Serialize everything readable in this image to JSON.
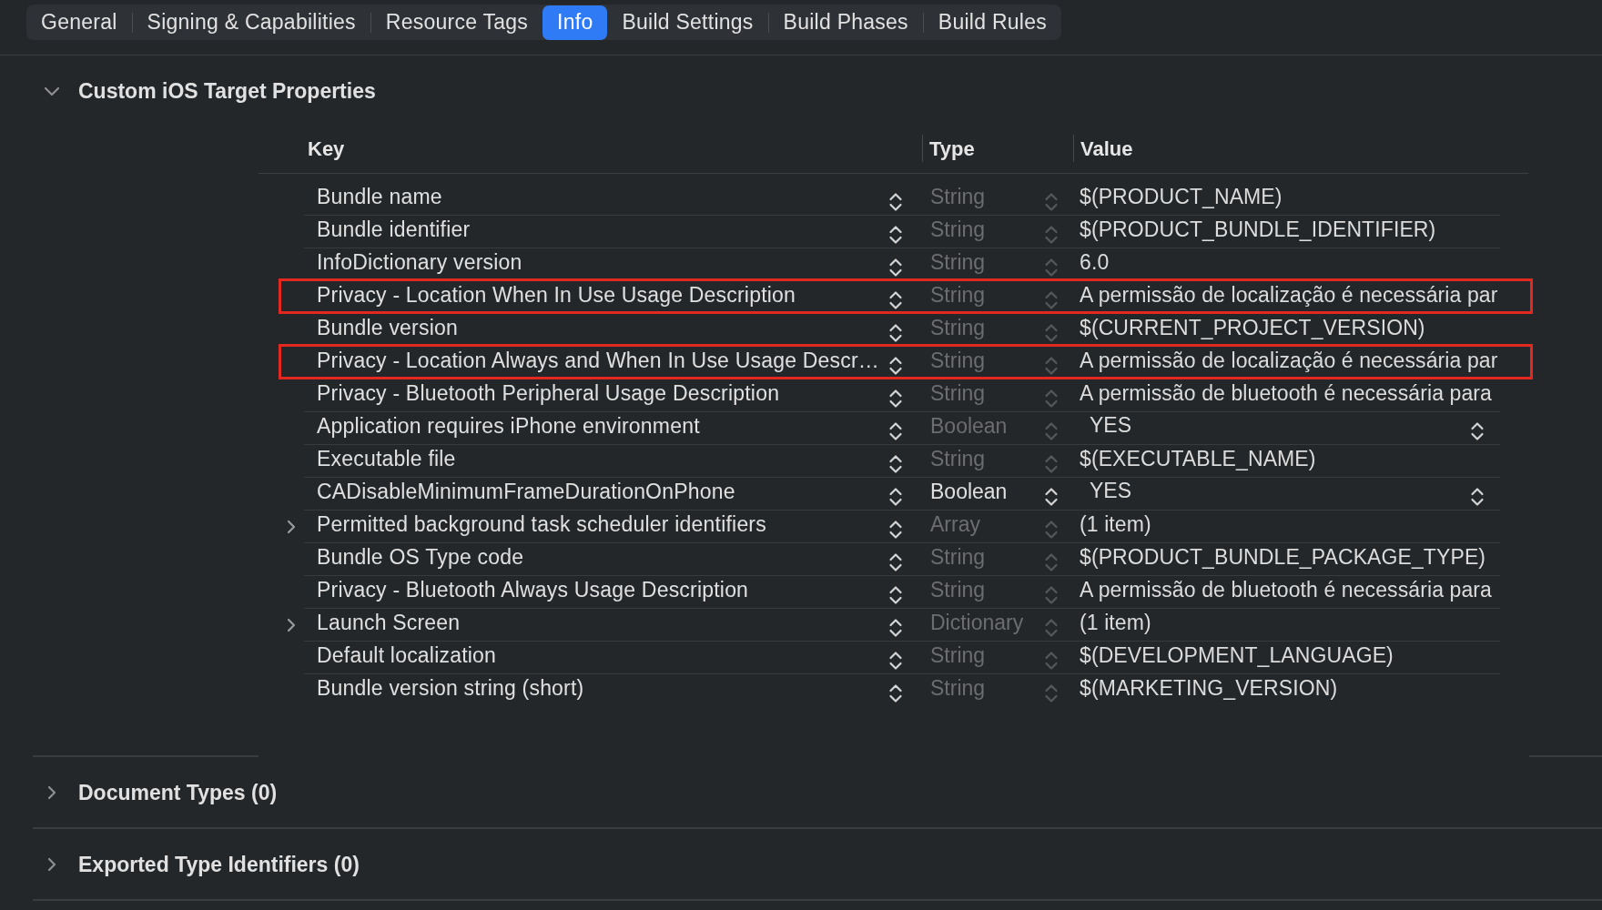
{
  "tabs": [
    {
      "label": "General",
      "selected": false
    },
    {
      "label": "Signing & Capabilities",
      "selected": false
    },
    {
      "label": "Resource Tags",
      "selected": false
    },
    {
      "label": "Info",
      "selected": true
    },
    {
      "label": "Build Settings",
      "selected": false
    },
    {
      "label": "Build Phases",
      "selected": false
    },
    {
      "label": "Build Rules",
      "selected": false
    }
  ],
  "sections": [
    {
      "title": "Custom iOS Target Properties",
      "expanded": true,
      "table": {
        "columns": [
          "Key",
          "Type",
          "Value"
        ],
        "rows": [
          {
            "kind": "text",
            "key": "Bundle name",
            "type": "String",
            "type_disabled": true,
            "value": "$(PRODUCT_NAME)",
            "highlighted": false
          },
          {
            "kind": "text",
            "key": "Bundle identifier",
            "type": "String",
            "type_disabled": true,
            "value": "$(PRODUCT_BUNDLE_IDENTIFIER)",
            "highlighted": false
          },
          {
            "kind": "text",
            "key": "InfoDictionary version",
            "type": "String",
            "type_disabled": true,
            "value": "6.0",
            "highlighted": false
          },
          {
            "kind": "text",
            "key": "Privacy - Location When In Use Usage Description",
            "type": "String",
            "type_disabled": true,
            "value": "A permissão de localização é necessária par",
            "highlighted": true
          },
          {
            "kind": "text",
            "key": "Bundle version",
            "type": "String",
            "type_disabled": true,
            "value": "$(CURRENT_PROJECT_VERSION)",
            "highlighted": false
          },
          {
            "kind": "text",
            "key": "Privacy - Location Always and When In Use Usage Descr…",
            "type": "String",
            "type_disabled": true,
            "value": "A permissão de localização é necessária par",
            "highlighted": true
          },
          {
            "kind": "text",
            "key": "Privacy - Bluetooth Peripheral Usage Description",
            "type": "String",
            "type_disabled": true,
            "value": "A permissão de bluetooth é necessária para",
            "highlighted": false
          },
          {
            "kind": "boolean",
            "key": "Application requires iPhone environment",
            "type": "Boolean",
            "type_disabled": true,
            "value": "YES",
            "highlighted": false
          },
          {
            "kind": "text",
            "key": "Executable file",
            "type": "String",
            "type_disabled": true,
            "value": "$(EXECUTABLE_NAME)",
            "highlighted": false
          },
          {
            "kind": "boolean",
            "key": "CADisableMinimumFrameDurationOnPhone",
            "type": "Boolean",
            "type_disabled": false,
            "value": "YES",
            "highlighted": false
          },
          {
            "kind": "collection",
            "key": "Permitted background task scheduler identifiers",
            "type": "Array",
            "type_disabled": true,
            "value": "(1 item)",
            "expanded": false,
            "highlighted": false
          },
          {
            "kind": "text",
            "key": "Bundle OS Type code",
            "type": "String",
            "type_disabled": true,
            "value": "$(PRODUCT_BUNDLE_PACKAGE_TYPE)",
            "highlighted": false
          },
          {
            "kind": "text",
            "key": "Privacy - Bluetooth Always Usage Description",
            "type": "String",
            "type_disabled": true,
            "value": "A permissão de bluetooth é necessária para",
            "highlighted": false
          },
          {
            "kind": "collection",
            "key": "Launch Screen",
            "type": "Dictionary",
            "type_disabled": true,
            "value": "(1 item)",
            "expanded": false,
            "highlighted": false
          },
          {
            "kind": "text",
            "key": "Default localization",
            "type": "String",
            "type_disabled": true,
            "value": "$(DEVELOPMENT_LANGUAGE)",
            "highlighted": false
          },
          {
            "kind": "text",
            "key": "Bundle version string (short)",
            "type": "String",
            "type_disabled": true,
            "value": "$(MARKETING_VERSION)",
            "highlighted": false
          }
        ]
      }
    },
    {
      "title": "Document Types (0)",
      "expanded": false
    },
    {
      "title": "Exported Type Identifiers (0)",
      "expanded": false
    }
  ]
}
